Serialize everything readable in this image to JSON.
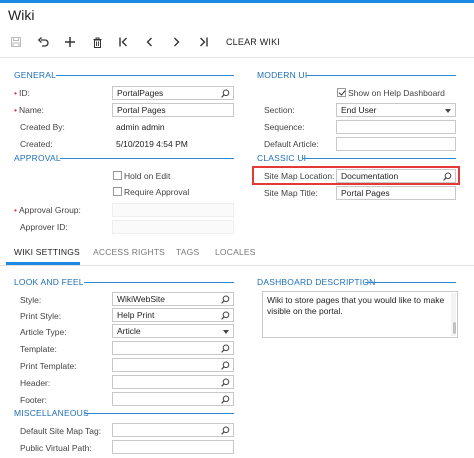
{
  "window": {
    "title": "Wiki"
  },
  "toolbar": {
    "clear_wiki_label": "CLEAR WIKI"
  },
  "general": {
    "header": "GENERAL",
    "id_label": "ID:",
    "id_value": "PortalPages",
    "name_label": "Name:",
    "name_value": "Portal Pages",
    "created_by_label": "Created By:",
    "created_by_value": "admin admin",
    "created_label": "Created:",
    "created_value": "5/10/2019 4:54 PM"
  },
  "approval": {
    "header": "APPROVAL",
    "hold_on_edit_label": "Hold on Edit",
    "require_approval_label": "Require Approval",
    "approval_group_label": "Approval Group:",
    "approver_id_label": "Approver ID:"
  },
  "modern_ui": {
    "header": "MODERN UI",
    "show_on_dashboard_label": "Show on Help Dashboard",
    "section_label": "Section:",
    "section_value": "End User",
    "sequence_label": "Sequence:",
    "sequence_value": "",
    "default_article_label": "Default Article:",
    "default_article_value": ""
  },
  "classic_ui": {
    "header": "CLASSIC UI",
    "site_map_location_label": "Site Map Location:",
    "site_map_location_value": "Documentation",
    "site_map_title_label": "Site Map Title:",
    "site_map_title_value": "Portal Pages"
  },
  "tabs": [
    {
      "label": "WIKI SETTINGS"
    },
    {
      "label": "ACCESS RIGHTS"
    },
    {
      "label": "TAGS"
    },
    {
      "label": "LOCALES"
    }
  ],
  "look_and_feel": {
    "header": "LOOK AND FEEL",
    "style_label": "Style:",
    "style_value": "WikiWebSite",
    "print_style_label": "Print Style:",
    "print_style_value": "Help Print",
    "article_type_label": "Article Type:",
    "article_type_value": "Article",
    "template_label": "Template:",
    "print_template_label": "Print Template:",
    "header_label": "Header:",
    "footer_label": "Footer:"
  },
  "miscellaneous": {
    "header": "MISCELLANEOUS",
    "default_site_map_tag_label": "Default Site Map Tag:",
    "public_virtual_path_label": "Public Virtual Path:"
  },
  "dashboard_description": {
    "header": "DASHBOARD DESCRIPTION",
    "text": "Wiki to store pages that you would like to make visible on the portal."
  },
  "colors": {
    "accent": "#1e88e5",
    "highlight": "#e53935",
    "section": "#1e6fb8"
  },
  "icons": [
    "save-icon",
    "undo-icon",
    "add-icon",
    "delete-icon",
    "first-icon",
    "previous-icon",
    "next-icon",
    "last-icon",
    "search-icon",
    "checkbox-icon",
    "dropdown-icon"
  ]
}
